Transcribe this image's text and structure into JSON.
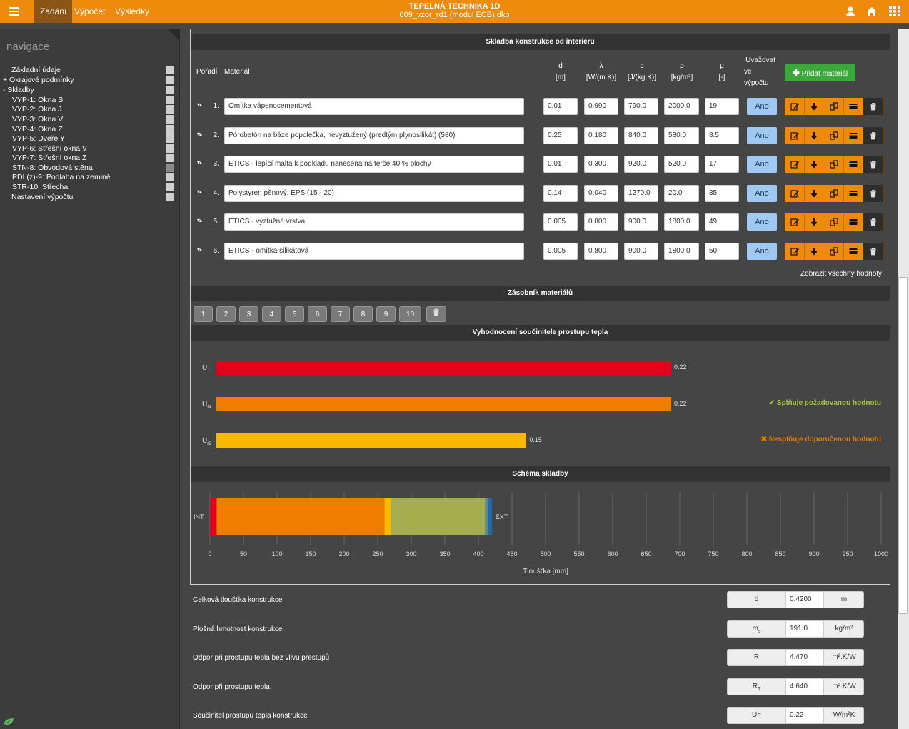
{
  "topbar": {
    "tabs": [
      "Zadání",
      "Výpočet",
      "Výsledky"
    ],
    "title": "TEPELNÁ TECHNIKA 1D",
    "subtitle": "009_vzor_rd1 (modul ECB).dkp"
  },
  "nav": {
    "title": "navigace",
    "items": [
      {
        "label": "Základní údaje",
        "dark": false
      },
      {
        "label": "+ Okrajové podmínky",
        "dark": false
      },
      {
        "label": "- Skladby",
        "dark": false
      },
      {
        "label": "VYP-1: Okna S",
        "dark": false
      },
      {
        "label": "VYP-2: Okna J",
        "dark": false
      },
      {
        "label": "VYP-3: Okna V",
        "dark": false
      },
      {
        "label": "VYP-4: Okna Z",
        "dark": false
      },
      {
        "label": "VYP-5: Dveře Y",
        "dark": false
      },
      {
        "label": "VYP-6: Střešní okna V",
        "dark": false
      },
      {
        "label": "VYP-7: Střešní okna Z",
        "dark": false
      },
      {
        "label": "STN-8: Obvodová stěna",
        "dark": true
      },
      {
        "label": "PDL(z)-9: Podlaha na zemině",
        "dark": false
      },
      {
        "label": "STR-10: Střecha",
        "dark": false
      },
      {
        "label": "Nastavení výpočtu",
        "dark": false
      }
    ]
  },
  "composition": {
    "title": "Skladba konstrukce od interiéru",
    "headers": {
      "order": "Pořadí",
      "material": "Materiál",
      "d": "d",
      "d_unit": "[m]",
      "lambda": "λ",
      "lambda_unit": "[W/(m.K)]",
      "c": "c",
      "c_unit": "[J/(kg.K)]",
      "rho": "ρ",
      "rho_unit": "[kg/m³]",
      "mu": "μ",
      "mu_unit": "[-]",
      "consider1": "Uvažovat",
      "consider2": "ve",
      "consider3": "výpočtu"
    },
    "add_button": "Přidat materiál",
    "rows": [
      {
        "n": "1.",
        "material": "Omítka vápenocementová",
        "d": "0.01",
        "lambda": "0.990",
        "c": "790.0",
        "rho": "2000.0",
        "mu": "19",
        "consider": "Ano"
      },
      {
        "n": "2.",
        "material": "Pórobetón na báze popolečka, nevyztužený (predtým plynosilikát) (580)",
        "d": "0.25",
        "lambda": "0.180",
        "c": "840.0",
        "rho": "580.0",
        "mu": "8.5",
        "consider": "Ano"
      },
      {
        "n": "3.",
        "material": "ETICS - lepící malta k podkladu nanesena na terče 40 % plochy",
        "d": "0.01",
        "lambda": "0.300",
        "c": "920.0",
        "rho": "520.0",
        "mu": "17",
        "consider": "Ano"
      },
      {
        "n": "4.",
        "material": "Polystyren pěnový, EPS (15 - 20)",
        "d": "0.14",
        "lambda": "0.040",
        "c": "1270.0",
        "rho": "20.0",
        "mu": "35",
        "consider": "Ano"
      },
      {
        "n": "5.",
        "material": "ETICS - výztužná vrstva",
        "d": "0.005",
        "lambda": "0.800",
        "c": "900.0",
        "rho": "1800.0",
        "mu": "49",
        "consider": "Ano"
      },
      {
        "n": "6.",
        "material": "ETICS - omítka silikátová",
        "d": "0.005",
        "lambda": "0.800",
        "c": "900.0",
        "rho": "1800.0",
        "mu": "50",
        "consider": "Ano"
      }
    ],
    "show_all": "Zobrazit všechny hodnoty"
  },
  "stack": {
    "title": "Zásobník materiálů",
    "buttons": [
      "1",
      "2",
      "3",
      "4",
      "5",
      "6",
      "7",
      "8",
      "9",
      "10"
    ]
  },
  "evaluation": {
    "title": "Vyhodnocení součinitele prostupu tepla",
    "max": 0.7,
    "bars": [
      {
        "label": "U",
        "sub": "",
        "value": 0.22,
        "text": "0.22",
        "color": "#e4001b"
      },
      {
        "label": "U",
        "sub": "N",
        "value": 0.22,
        "text": "0.22",
        "color": "#ee7d00"
      },
      {
        "label": "U",
        "sub": "r2",
        "value": 0.15,
        "text": "0.15",
        "color": "#f9b900"
      }
    ],
    "status_ok": "Splňuje požadovanou hodnotu",
    "status_fail": "Nesplňuje doporučenou hodnotu",
    "ok_color": "#a5c245",
    "fail_color": "#ee7d00"
  },
  "chart_data": {
    "type": "bar",
    "title": "Schéma skladby",
    "xlabel": "Tloušťka [mm]",
    "xlim": [
      0,
      1000
    ],
    "ticks": [
      "0",
      "50",
      "100",
      "150",
      "200",
      "250",
      "300",
      "350",
      "400",
      "450",
      "500",
      "550",
      "600",
      "650",
      "700",
      "750",
      "800",
      "850",
      "900",
      "950",
      "1000"
    ],
    "label_int": "INT",
    "label_ext": "EXT",
    "layers": [
      {
        "thickness": 10,
        "color": "#e4001b"
      },
      {
        "thickness": 250,
        "color": "#ee7d00"
      },
      {
        "thickness": 10,
        "color": "#f9b900"
      },
      {
        "thickness": 140,
        "color": "#a5ad4f"
      },
      {
        "thickness": 5,
        "color": "#5a8a8a"
      },
      {
        "thickness": 5,
        "color": "#1f6bb0"
      }
    ]
  },
  "results": [
    {
      "label": "Celková tloušťka konstrukce",
      "sym": "d",
      "sub": "",
      "val": "0.4200",
      "unit": "m"
    },
    {
      "label": "Plošná hmotnost konstrukce",
      "sym": "m",
      "sub": "s",
      "val": "191.0",
      "unit": "kg/m²"
    },
    {
      "label": "Odpor při prostupu tepla bez vlivu přestupů",
      "sym": "R",
      "sub": "",
      "val": "4.470",
      "unit": "m².K/W"
    },
    {
      "label": "Odpor při prostupu tepla",
      "sym": "R",
      "sub": "T",
      "val": "4.640",
      "unit": "m².K/W"
    },
    {
      "label": "Součinitel prostupu tepla konstrukce",
      "sym": "U=",
      "sub": "",
      "val": "0.22",
      "unit": "W/m²K"
    }
  ]
}
